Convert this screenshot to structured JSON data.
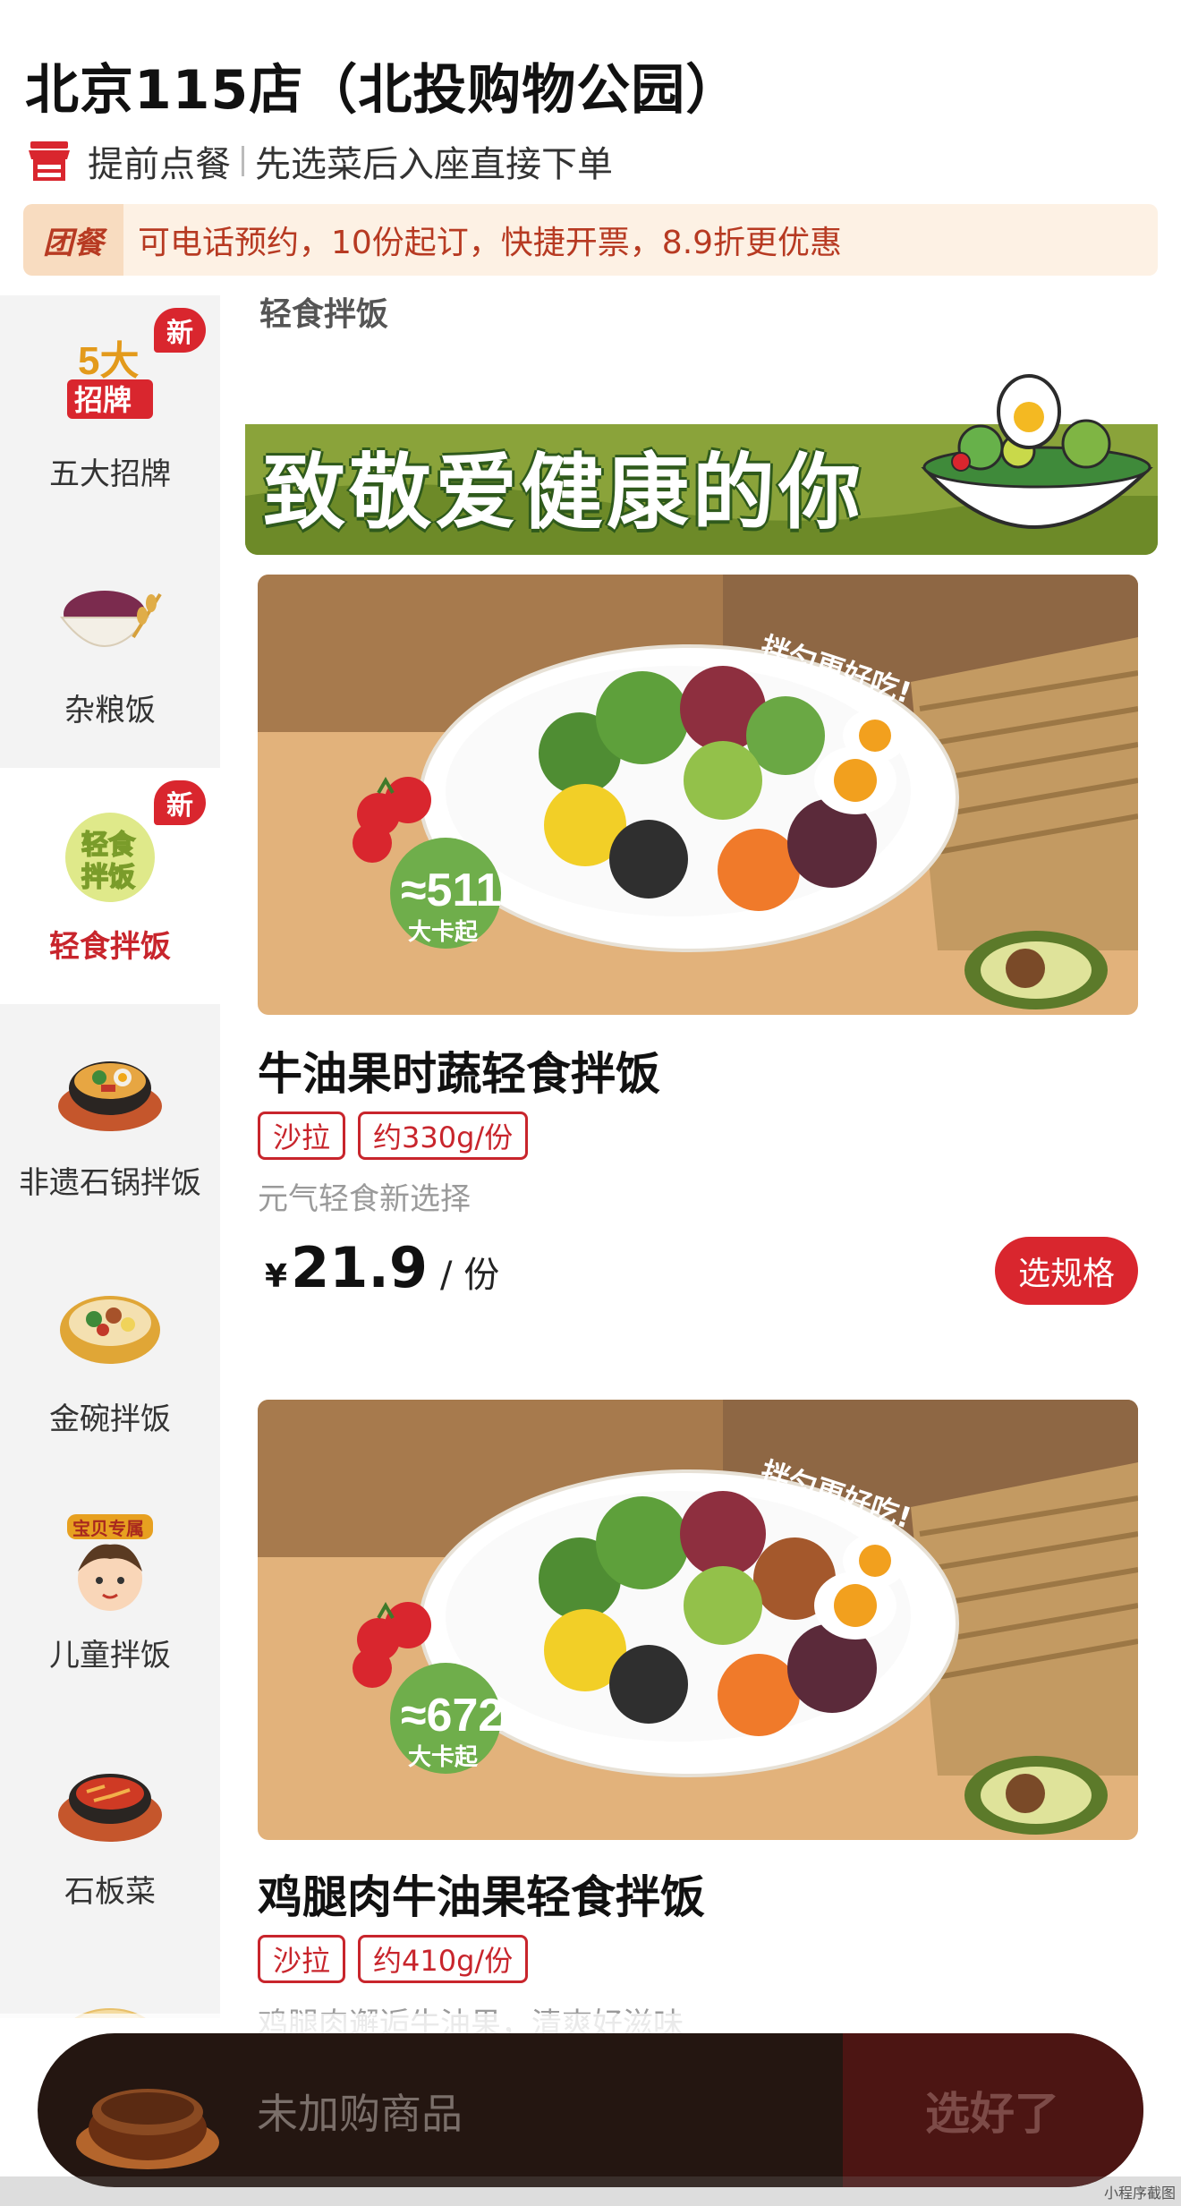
{
  "header": {
    "store_name": "北京115店（北投购物公园）",
    "pre_order_label": "提前点餐",
    "pre_order_desc": "先选菜后入座直接下单"
  },
  "group_banner": {
    "tag": "团餐",
    "text": "可电话预约，10份起订，快捷开票，8.9折更优惠"
  },
  "sidebar": {
    "items": [
      {
        "label": "五大招牌",
        "badge": "新",
        "icon_text_1": "5大",
        "icon_text_2": "招牌"
      },
      {
        "label": "杂粮饭"
      },
      {
        "label": "轻食拌饭",
        "badge": "新",
        "icon_text_1": "轻食",
        "icon_text_2": "拌饭"
      },
      {
        "label": "非遗石锅拌饭"
      },
      {
        "label": "金碗拌饭"
      },
      {
        "label": "儿童拌饭",
        "icon_text_1": "宝贝专属"
      },
      {
        "label": "石板菜"
      }
    ]
  },
  "section": {
    "title": "轻食拌饭"
  },
  "promo_banner": {
    "text": "致敬爱健康的你"
  },
  "products": [
    {
      "name": "牛油果时蔬轻食拌饭",
      "tags": [
        "沙拉",
        "约330g/份"
      ],
      "desc": "元气轻食新选择",
      "currency": "¥",
      "price": "21.9",
      "unit": "/ 份",
      "button": "选规格",
      "img_slogan": "拌匀更好吃!",
      "img_kcal": "≈511",
      "img_kcal_unit": "大卡起"
    },
    {
      "name": "鸡腿肉牛油果轻食拌饭",
      "tags": [
        "沙拉",
        "约410g/份"
      ],
      "desc": "鸡腿肉邂逅牛油果，清爽好滋味",
      "img_slogan": "拌匀更好吃!",
      "img_kcal": "≈672",
      "img_kcal_unit": "大卡起"
    }
  ],
  "cart": {
    "empty_text": "未加购商品",
    "checkout_label": "选好了"
  },
  "footer": {
    "screenshot_label": "小程序截图"
  },
  "colors": {
    "accent": "#d9262e",
    "cart_bg": "#241611",
    "cart_right": "#4c1513",
    "banner_bg": "#fdf1e4"
  }
}
